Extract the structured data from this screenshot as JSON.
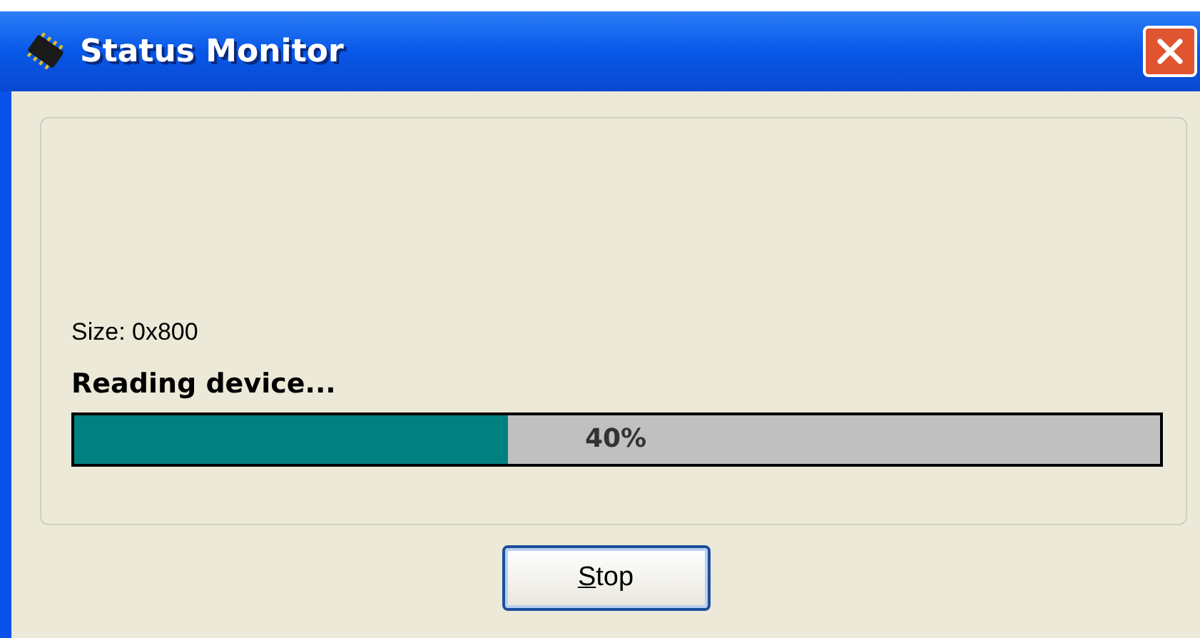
{
  "window": {
    "title": "Status Monitor"
  },
  "size_label": "Size: 0x800",
  "status": "Reading device...",
  "progress": {
    "level": 0.4,
    "reading": "40%"
  },
  "stop_button": {
    "label_parts": [
      {
        "text": "S",
        "underlined": true
      },
      {
        "text": "top",
        "underlined": false
      }
    ]
  }
}
